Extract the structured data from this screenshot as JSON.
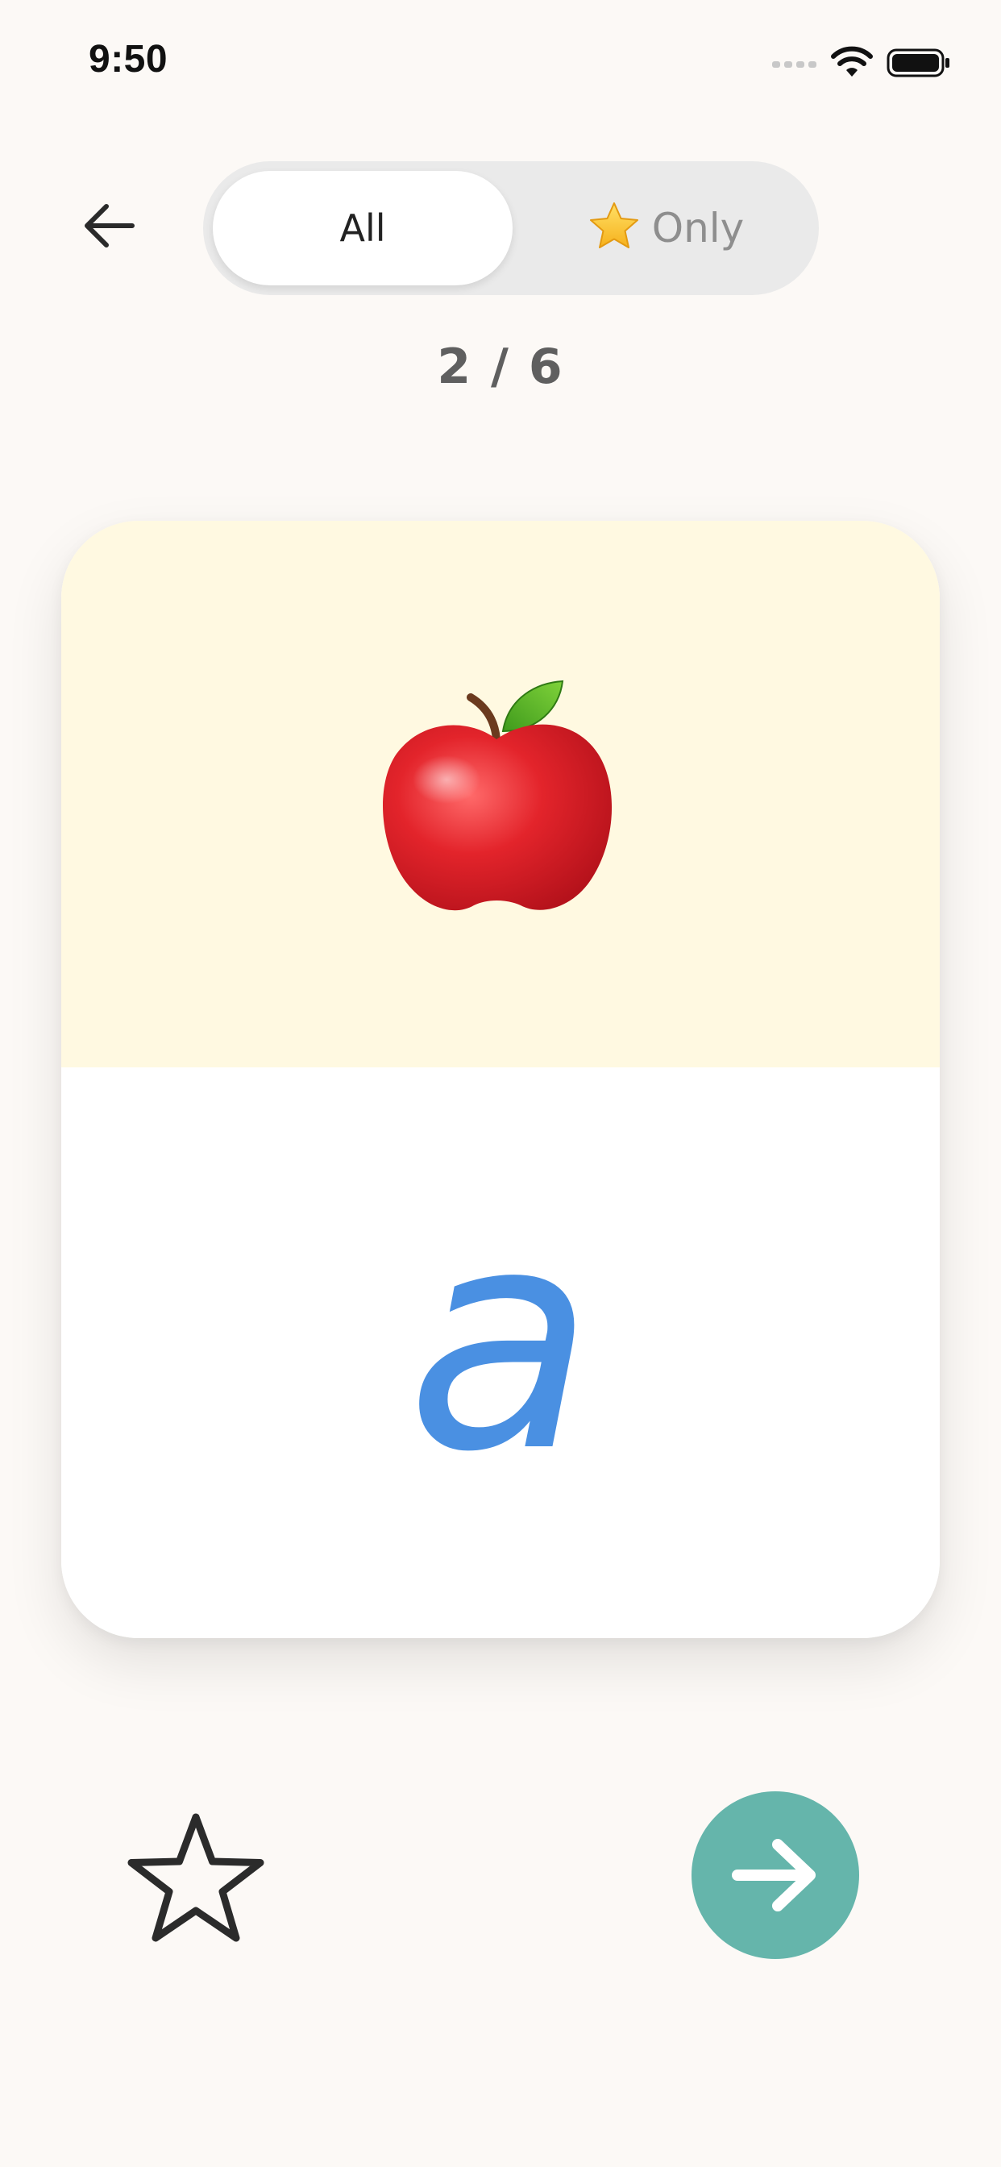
{
  "status_bar": {
    "time": "9:50"
  },
  "header": {
    "back_icon": "arrow-left-icon",
    "filter": {
      "all_label": "All",
      "only_label": "Only",
      "only_icon": "star-emoji-icon",
      "selected": "All"
    }
  },
  "progress": {
    "text": "2 / 6",
    "current": 2,
    "total": 6
  },
  "card": {
    "picture_icon": "red-apple-icon",
    "letter": "a"
  },
  "controls": {
    "favorite_icon": "star-outline-icon",
    "next_icon": "arrow-right-icon"
  },
  "colors": {
    "background": "#fcf9f6",
    "card_top": "#fff9e1",
    "letter": "#4a90e2",
    "next_button": "#65b5ab",
    "segment_track": "#eaeaea"
  }
}
